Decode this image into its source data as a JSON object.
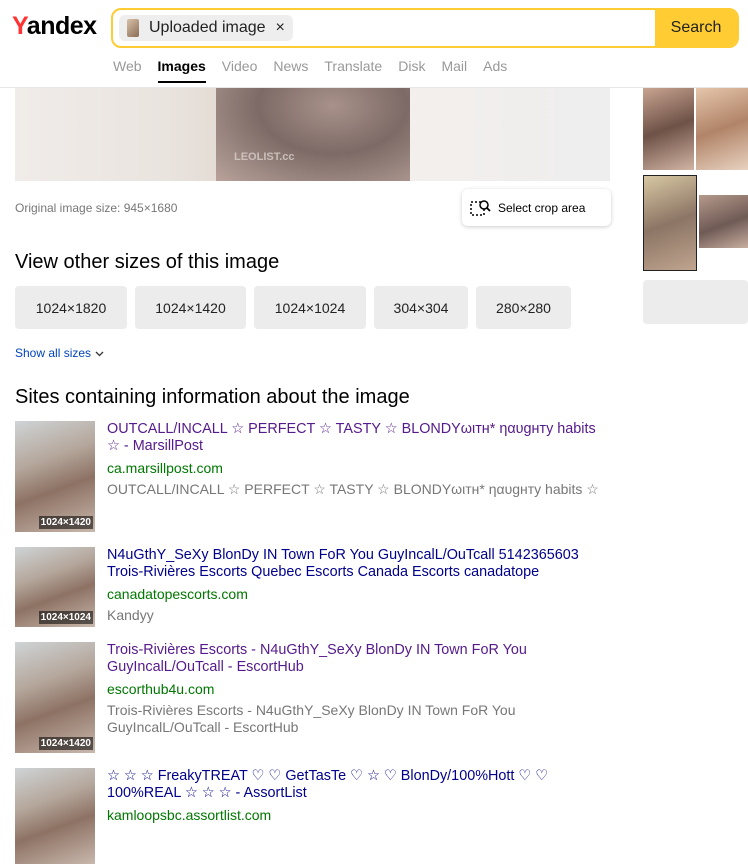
{
  "logo": {
    "y": "Y",
    "rest": "andex"
  },
  "search": {
    "chip_label": "Uploaded image",
    "close_glyph": "×",
    "button_label": "Search"
  },
  "tabs": [
    "Web",
    "Images",
    "Video",
    "News",
    "Translate",
    "Disk",
    "Mail",
    "Ads"
  ],
  "preview": {
    "watermark": "LEOLIST.cc"
  },
  "original_size": "Original image size: 945×1680",
  "crop_label": "Select crop area",
  "other_sizes": {
    "heading": "View other sizes of this image",
    "sizes": [
      "1024×1820",
      "1024×1420",
      "1024×1024",
      "304×304",
      "280×280"
    ],
    "show_all": "Show all sizes"
  },
  "sites": {
    "heading": "Sites containing information about the image",
    "results": [
      {
        "title": "OUTCALL/INCALL ☆ PERFECT ☆ TASTY ☆ BLONDYωιтн* ηαυgнтy habits ☆ - MarsillPost",
        "domain": "ca.marsillpost.com",
        "desc": "OUTCALL/INCALL ☆ PERFECT ☆ TASTY ☆ BLONDYωιтн* ηαυgнтy habits ☆",
        "thumb_size": "1024×1420",
        "visited": true
      },
      {
        "title": "N4uGthY_SeXy BlonDy IN Town FoR You GuyIncalL/OuTcall 5142365603 Trois-Rivières Escorts Quebec Escorts Canada Escorts canadatope",
        "domain": "canadatopescorts.com",
        "desc": "Kandyy",
        "thumb_size": "1024×1024",
        "visited": false
      },
      {
        "title": "Trois-Rivières Escorts - N4uGthY_SeXy BlonDy IN Town FoR You GuyIncalL/OuTcall - EscortHub",
        "domain": "escorthub4u.com",
        "desc": "Trois-Rivières Escorts - N4uGthY_SeXy BlonDy IN Town FoR You GuyIncalL/OuTcall - EscortHub",
        "thumb_size": "1024×1420",
        "visited": true
      },
      {
        "title": "☆ ☆ ☆ FreakyTREAT ♡ ♡ GetTasTe ♡ ☆ ♡ BlonDy/100%Hott ♡ ♡ 100%REAL ☆ ☆ ☆ - AssortList",
        "domain": "kamloopsbc.assortlist.com",
        "desc": "",
        "thumb_size": "",
        "visited": false
      }
    ]
  },
  "colors": {
    "accent": "#ffcc33",
    "logo_red": "#ff3333",
    "domain_green": "#007700",
    "visited": "#551a8b",
    "link": "#00008b"
  }
}
